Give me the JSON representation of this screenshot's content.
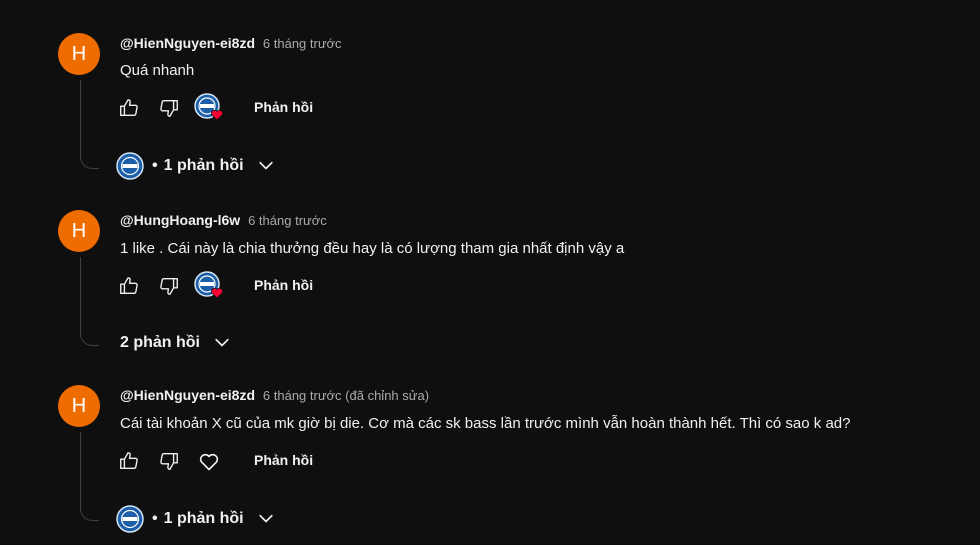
{
  "comments": [
    {
      "avatar_letter": "H",
      "author": "@HienNguyen-ei8zd",
      "time": "6 tháng trước",
      "text": "Quá nhanh",
      "reply_label": "Phản hồi",
      "creator_hearted": true,
      "replies_label": "1 phản hồi",
      "replies_has_avatar": true
    },
    {
      "avatar_letter": "H",
      "author": "@HungHoang-l6w",
      "time": "6 tháng trước",
      "text": "1 like . Cái này là chia thưởng đều hay là có lượng tham gia nhất định vậy a",
      "reply_label": "Phản hồi",
      "creator_hearted": true,
      "replies_label": "2 phản hồi",
      "replies_has_avatar": false
    },
    {
      "avatar_letter": "H",
      "author": "@HienNguyen-ei8zd",
      "time": "6 tháng trước (đã chỉnh sửa)",
      "text": "Cái tài khoản X cũ của mk giờ bị die. Cơ mà các sk bass lần trước mình vẫn hoàn thành hết. Thì có sao k ad?",
      "reply_label": "Phản hồi",
      "creator_hearted": false,
      "replies_label": "1 phản hồi",
      "replies_has_avatar": true
    }
  ],
  "colors": {
    "background": "#0f0f0f",
    "avatar": "#ef6c00",
    "heart": "#ff0033",
    "channel_badge": "#1c5fa8"
  },
  "icons": {
    "like": "thumb-up-icon",
    "dislike": "thumb-down-icon",
    "creator_heart": "creator-heart-icon",
    "heart_outline": "heart-outline-icon",
    "chevron": "chevron-down-icon"
  }
}
